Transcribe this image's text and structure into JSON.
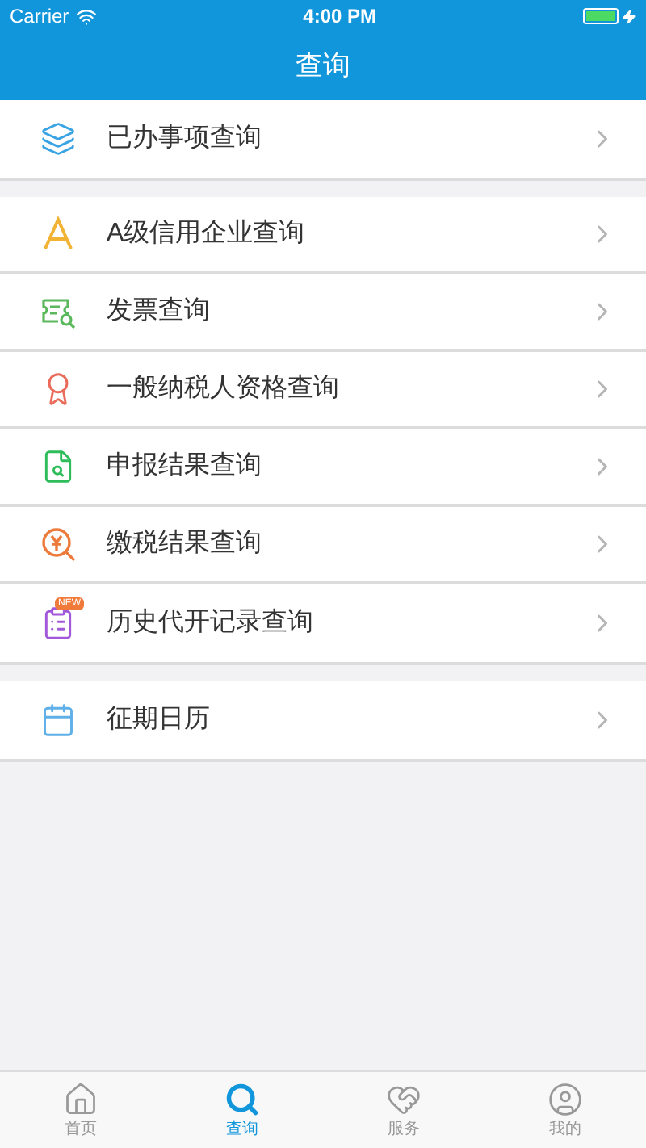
{
  "status_bar": {
    "carrier": "Carrier",
    "time": "4:00 PM"
  },
  "nav_bar": {
    "title": "查询"
  },
  "groups": [
    {
      "items": [
        {
          "kind": "layers",
          "label": "已办事项查询",
          "color": "#3aa3e3"
        }
      ]
    },
    {
      "items": [
        {
          "kind": "letter",
          "label": "A级信用企业查询",
          "color": "#f2b233"
        },
        {
          "kind": "invoice",
          "label": "发票查询",
          "color": "#5cb85c"
        },
        {
          "kind": "award",
          "label": "一般纳税人资格查询",
          "color": "#ea6b5a"
        },
        {
          "kind": "file-search",
          "label": "申报结果查询",
          "color": "#2ebd5a"
        },
        {
          "kind": "yen-search",
          "label": "缴税结果查询",
          "color": "#ec7a3a"
        },
        {
          "kind": "list",
          "label": "历史代开记录查询",
          "color": "#a259d9",
          "badge": "NEW"
        }
      ]
    },
    {
      "items": [
        {
          "kind": "calendar",
          "label": "征期日历",
          "color": "#5fb0e8"
        }
      ]
    }
  ],
  "tab_bar": [
    {
      "kind": "home",
      "label": "首页",
      "selected": false
    },
    {
      "kind": "search",
      "label": "查询",
      "selected": true
    },
    {
      "kind": "heart",
      "label": "服务",
      "selected": false
    },
    {
      "kind": "user",
      "label": "我的",
      "selected": false
    }
  ]
}
